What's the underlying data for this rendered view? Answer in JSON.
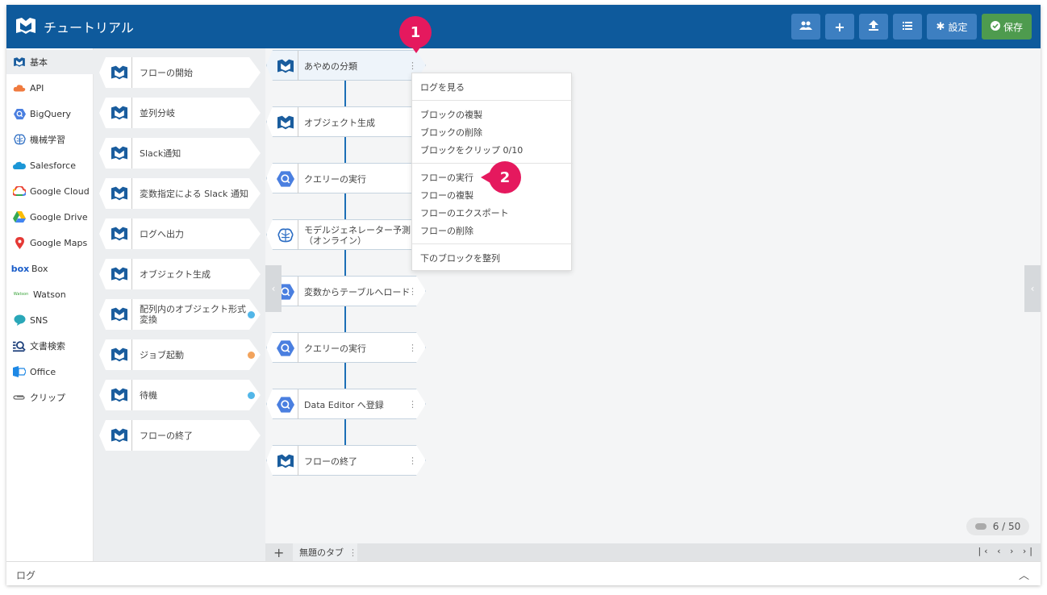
{
  "header": {
    "title": "チュートリアル",
    "settings_label": "設定",
    "save_label": "保存"
  },
  "sidebar": {
    "items": [
      {
        "label": "基本",
        "icon": "blocks-logo-icon"
      },
      {
        "label": "API",
        "icon": "api-cloud-icon"
      },
      {
        "label": "BigQuery",
        "icon": "bigquery-icon"
      },
      {
        "label": "機械学習",
        "icon": "brain-icon"
      },
      {
        "label": "Salesforce",
        "icon": "salesforce-cloud-icon"
      },
      {
        "label": "Google Cloud",
        "icon": "google-cloud-icon"
      },
      {
        "label": "Google Drive",
        "icon": "google-drive-icon"
      },
      {
        "label": "Google Maps",
        "icon": "map-pin-icon"
      },
      {
        "label": "Box",
        "icon": "box-logo-icon",
        "logo_text": "box"
      },
      {
        "label": "Watson",
        "icon": "watson-logo-icon",
        "logo_text": "Watson"
      },
      {
        "label": "SNS",
        "icon": "chat-bubble-icon"
      },
      {
        "label": "文書検索",
        "icon": "document-search-icon"
      },
      {
        "label": "Office",
        "icon": "office-icon"
      },
      {
        "label": "クリップ",
        "icon": "paperclip-icon"
      }
    ]
  },
  "palette": {
    "blocks": [
      {
        "label": "フローの開始"
      },
      {
        "label": "並列分岐"
      },
      {
        "label": "Slack通知"
      },
      {
        "label": "変数指定による Slack 通知"
      },
      {
        "label": "ログへ出力"
      },
      {
        "label": "オブジェクト生成"
      },
      {
        "label": "配列内のオブジェクト形式",
        "label2": "変換"
      },
      {
        "label": "ジョブ起動"
      },
      {
        "label": "待機"
      },
      {
        "label": "フローの終了"
      }
    ]
  },
  "flow": {
    "nodes": [
      {
        "label": "あやめの分類",
        "icon": "blocks-logo-icon"
      },
      {
        "label": "オブジェクト生成",
        "icon": "blocks-logo-icon"
      },
      {
        "label": "クエリーの実行",
        "icon": "bigquery-icon"
      },
      {
        "label": "モデルジェネレーター予測",
        "label2": "（オンライン）",
        "icon": "brain-icon"
      },
      {
        "label": "変数からテーブルへロード",
        "icon": "bigquery-icon"
      },
      {
        "label": "クエリーの実行",
        "icon": "bigquery-icon"
      },
      {
        "label": "Data Editor へ登録",
        "icon": "bigquery-icon"
      },
      {
        "label": "フローの終了",
        "icon": "blocks-logo-icon"
      }
    ]
  },
  "context_menu": {
    "items": [
      "ログを見る",
      "ブロックの複製",
      "ブロックの削除",
      "ブロックをクリップ 0/10",
      "フローの実行",
      "フローの複製",
      "フローのエクスポート",
      "フローの削除",
      "下のブロックを整列"
    ]
  },
  "badges": {
    "first": "1",
    "second": "2"
  },
  "counter": {
    "text": "6 / 50"
  },
  "tabs": {
    "active_label": "無題のタブ"
  },
  "log": {
    "label": "ログ"
  },
  "colors": {
    "header": "#0e5a9c",
    "header_button": "#3d7fc1",
    "save_button": "#4e9b4e",
    "flow_line": "#1c6eb6",
    "badge": "#e5195e"
  }
}
